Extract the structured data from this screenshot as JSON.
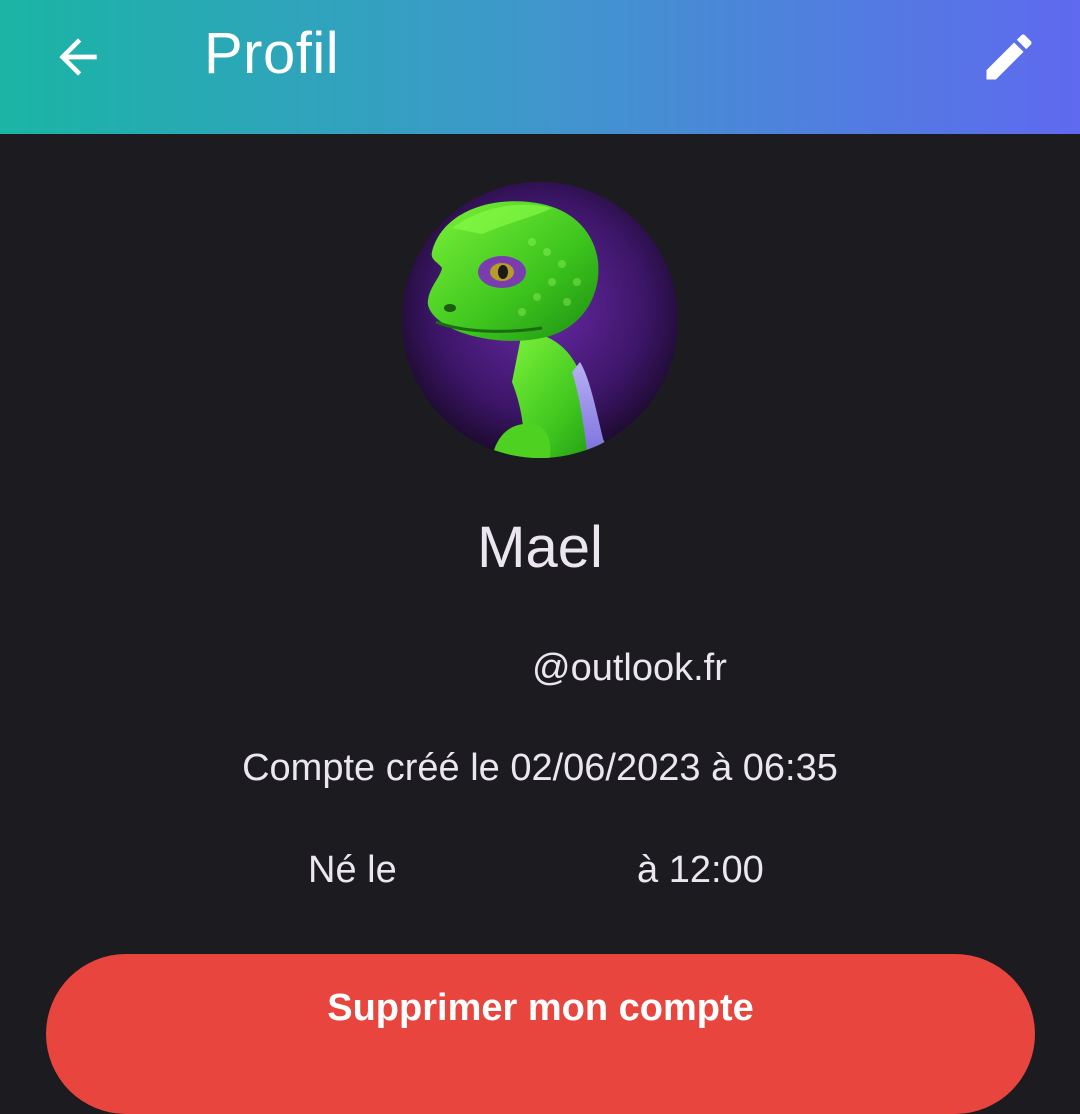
{
  "app_bar": {
    "title": "Profil",
    "back_icon": "arrow-back-icon",
    "edit_icon": "pencil-edit-icon",
    "gradient_start": "#1ab5a5",
    "gradient_end": "#5f69ef"
  },
  "profile": {
    "avatar_description_icon": "green-lizard-avatar",
    "name": "Mael",
    "email": "@outlook.fr",
    "created": "Compte créé le 02/06/2023 à 06:35",
    "born_label": "Né le",
    "born_time": "à 12:00"
  },
  "actions": {
    "delete_label": "Supprimer mon compte",
    "delete_color": "#e8453e"
  },
  "theme": {
    "background": "#1c1b1f",
    "text": "#ece6f0"
  }
}
